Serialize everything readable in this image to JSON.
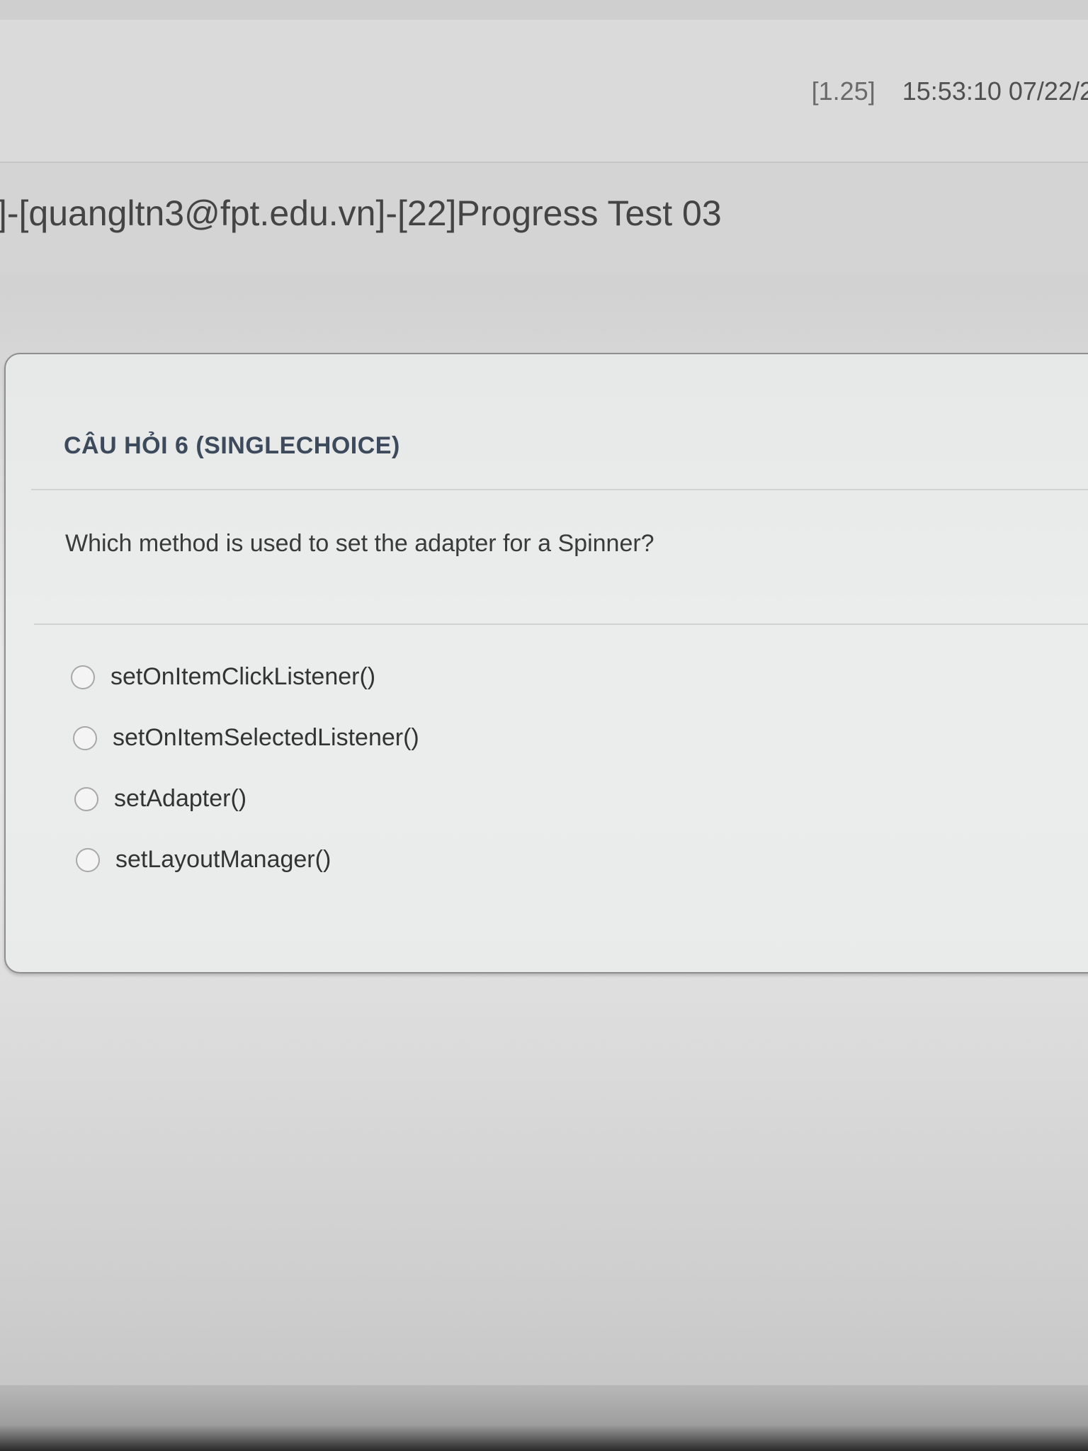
{
  "header": {
    "score": "[1.25]",
    "timestamp": "15:53:10 07/22/2"
  },
  "exam": {
    "title": "]-[quangltn3@fpt.edu.vn]-[22]Progress Test 03"
  },
  "question": {
    "header": "CÂU HỎI 6 (SINGLECHOICE)",
    "text": "Which method is used to set the adapter for a Spinner?",
    "options": [
      {
        "label": "setOnItemClickListener()",
        "selected": false
      },
      {
        "label": "setOnItemSelectedListener()",
        "selected": false
      },
      {
        "label": "setAdapter()",
        "selected": false
      },
      {
        "label": "setLayoutManager()",
        "selected": false
      }
    ]
  }
}
